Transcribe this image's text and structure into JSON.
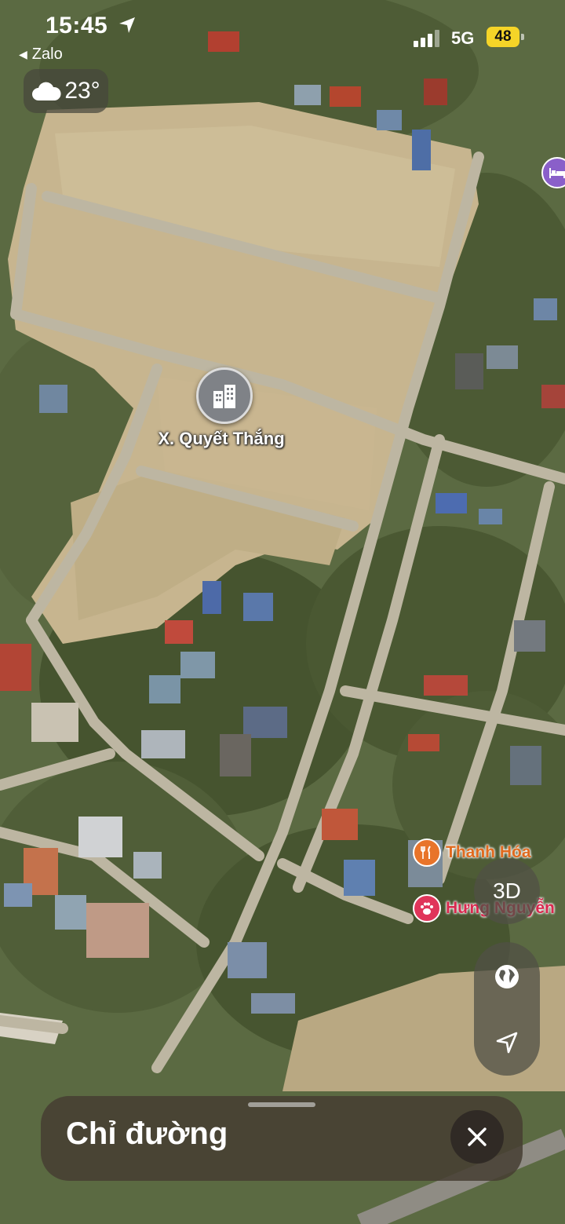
{
  "status_bar": {
    "time": "15:45",
    "back_app": "Zalo",
    "network": "5G",
    "battery": "48"
  },
  "weather": {
    "temperature": "23°",
    "icon": "cloud-icon"
  },
  "map": {
    "type": "satellite",
    "main_pin": {
      "label": "X. Quyết Thắng",
      "icon": "buildings-icon"
    },
    "pois": [
      {
        "label": "Thanh Hóa",
        "icon": "fork-knife-icon",
        "color": "#e8742a"
      },
      {
        "label": "Hưng Nguyễn",
        "icon": "paw-icon",
        "color": "#e0355a"
      }
    ],
    "hotel_pin": {
      "icon": "bed-icon",
      "color": "#8a5fc9"
    }
  },
  "controls": {
    "view_3d_label": "3D",
    "globe_icon": "globe-icon",
    "locate_icon": "location-arrow-icon"
  },
  "directions_sheet": {
    "title": "Chỉ đường",
    "close_icon": "close-icon"
  }
}
